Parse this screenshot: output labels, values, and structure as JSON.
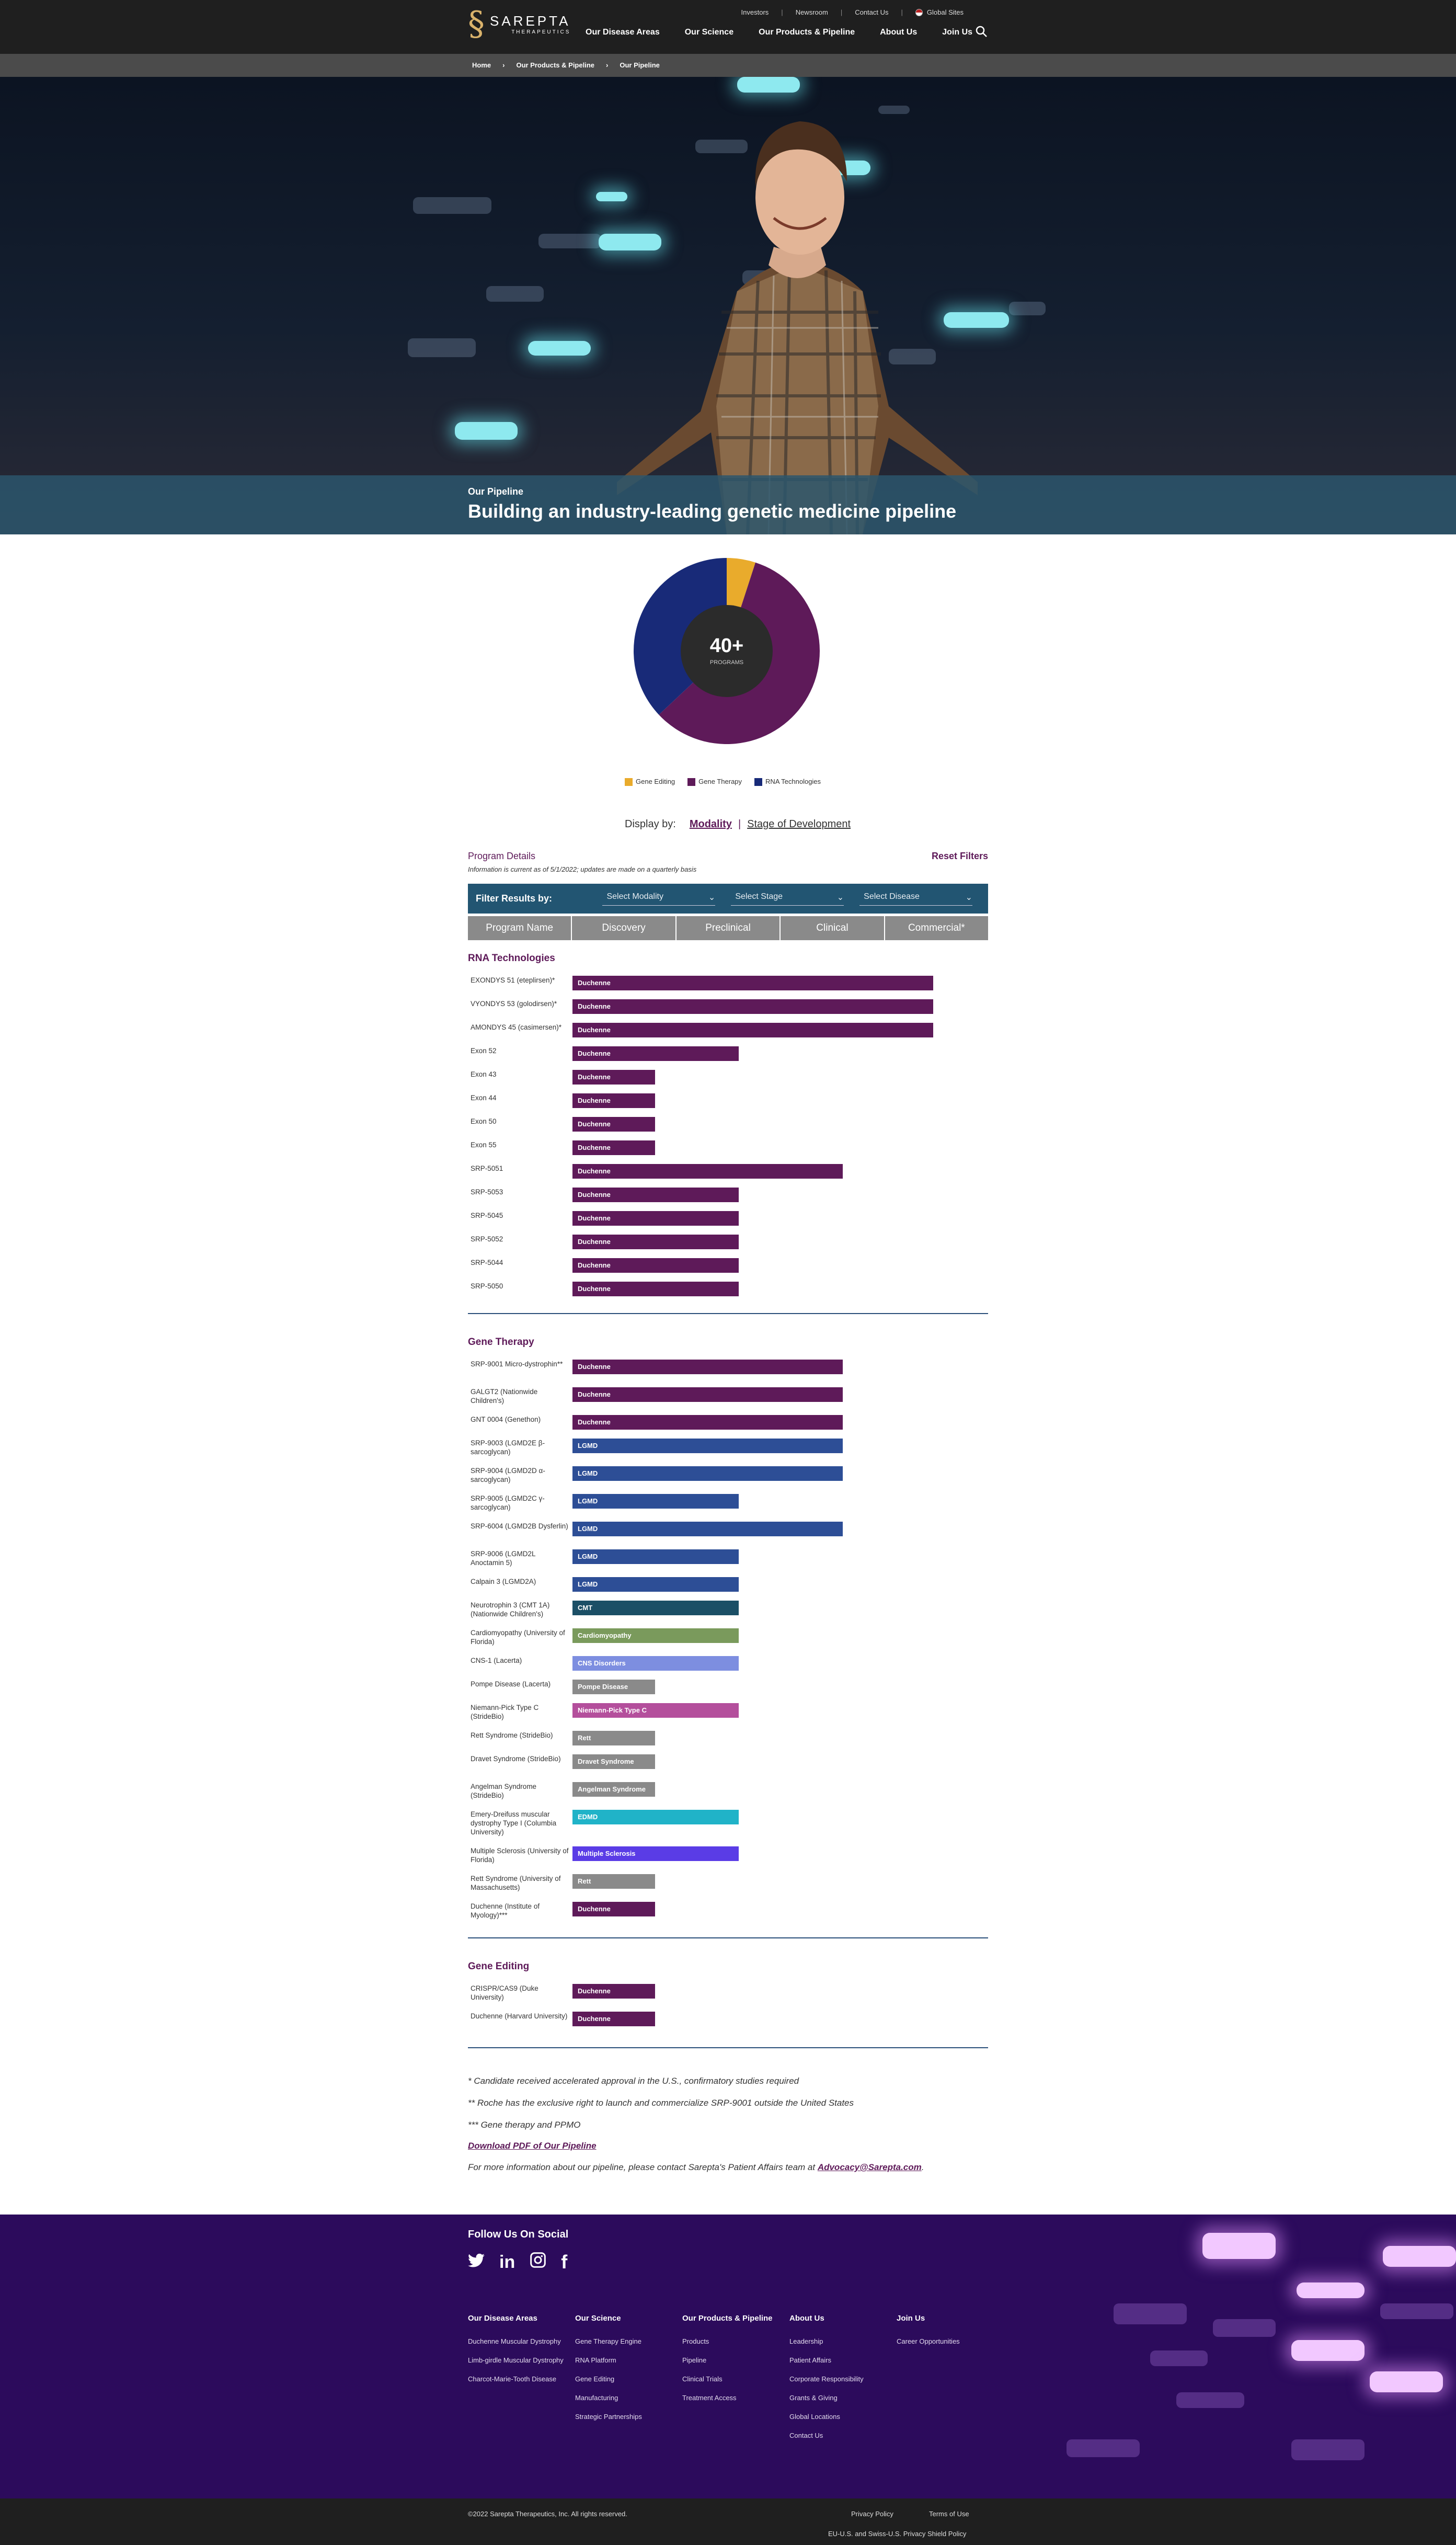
{
  "header": {
    "logo_name": "SAREPTA",
    "logo_sub": "THERAPEUTICS",
    "utility": [
      "Investors",
      "Newsroom",
      "Contact Us",
      "Global Sites"
    ],
    "nav": [
      "Our Disease Areas",
      "Our Science",
      "Our Products & Pipeline",
      "About Us",
      "Join Us"
    ]
  },
  "breadcrumb": [
    "Home",
    "Our Products & Pipeline",
    "Our Pipeline"
  ],
  "hero": {
    "subtitle": "Our Pipeline",
    "title": "Building an industry-leading genetic medicine pipeline"
  },
  "pie": {
    "center_value": "40+",
    "center_label": "PROGRAMS",
    "slices": [
      {
        "name": "Gene Editing",
        "fraction": 0.05,
        "color": "#e9ab2c"
      },
      {
        "name": "Gene Therapy",
        "fraction": 0.58,
        "color": "#5e1a59"
      },
      {
        "name": "RNA Technologies",
        "fraction": 0.37,
        "color": "#182a78"
      }
    ]
  },
  "display_by": {
    "label": "Display by:",
    "option1": "Modality",
    "option2": "Stage of Development"
  },
  "program_details": {
    "title": "Program Details",
    "reset": "Reset Filters",
    "note": "Information is current as of 5/1/2022; updates are made on a quarterly basis"
  },
  "filters": {
    "label": "Filter Results by:",
    "modality": "Select Modality",
    "stage": "Select Stage",
    "disease": "Select Disease"
  },
  "columns": [
    "Program Name",
    "Discovery",
    "Preclinical",
    "Clinical",
    "Commercial*"
  ],
  "sections": [
    {
      "title": "RNA Technologies",
      "rows": [
        {
          "name": "EXONDYS 51 (eteplirsen)*",
          "label": "Duchenne",
          "stage": 4,
          "color": "#5e1a59"
        },
        {
          "name": "VYONDYS 53 (golodirsen)*",
          "label": "Duchenne",
          "stage": 4,
          "color": "#5e1a59"
        },
        {
          "name": "AMONDYS 45 (casimersen)*",
          "label": "Duchenne",
          "stage": 4,
          "color": "#5e1a59"
        },
        {
          "name": "Exon 52",
          "label": "Duchenne",
          "stage": 2,
          "color": "#5e1a59"
        },
        {
          "name": "Exon 43",
          "label": "Duchenne",
          "stage": 1,
          "color": "#5e1a59"
        },
        {
          "name": "Exon 44",
          "label": "Duchenne",
          "stage": 1,
          "color": "#5e1a59"
        },
        {
          "name": "Exon 50",
          "label": "Duchenne",
          "stage": 1,
          "color": "#5e1a59"
        },
        {
          "name": "Exon 55",
          "label": "Duchenne",
          "stage": 1,
          "color": "#5e1a59"
        },
        {
          "name": "SRP-5051",
          "label": "Duchenne",
          "stage": 3,
          "color": "#5e1a59"
        },
        {
          "name": "SRP-5053",
          "label": "Duchenne",
          "stage": 2,
          "color": "#5e1a59"
        },
        {
          "name": "SRP-5045",
          "label": "Duchenne",
          "stage": 2,
          "color": "#5e1a59"
        },
        {
          "name": "SRP-5052",
          "label": "Duchenne",
          "stage": 2,
          "color": "#5e1a59"
        },
        {
          "name": "SRP-5044",
          "label": "Duchenne",
          "stage": 2,
          "color": "#5e1a59"
        },
        {
          "name": "SRP-5050",
          "label": "Duchenne",
          "stage": 2,
          "color": "#5e1a59"
        }
      ]
    },
    {
      "title": "Gene Therapy",
      "rows": [
        {
          "name": "SRP-9001 Micro-dystrophin**",
          "label": "Duchenne",
          "stage": 3,
          "color": "#5e1a59"
        },
        {
          "name": "GALGT2 (Nationwide Children's)",
          "label": "Duchenne",
          "stage": 3,
          "color": "#5e1a59"
        },
        {
          "name": "GNT 0004 (Genethon)",
          "label": "Duchenne",
          "stage": 3,
          "color": "#5e1a59"
        },
        {
          "name": "SRP-9003 (LGMD2E β-sarcoglycan)",
          "label": "LGMD",
          "stage": 3,
          "color": "#2d4e96"
        },
        {
          "name": "SRP-9004 (LGMD2D α-sarcoglycan)",
          "label": "LGMD",
          "stage": 3,
          "color": "#2d4e96"
        },
        {
          "name": "SRP-9005 (LGMD2C γ-sarcoglycan)",
          "label": "LGMD",
          "stage": 2,
          "color": "#2d4e96"
        },
        {
          "name": "SRP-6004 (LGMD2B Dysferlin)",
          "label": "LGMD",
          "stage": 3,
          "color": "#2d4e96"
        },
        {
          "name": "SRP-9006 (LGMD2L Anoctamin 5)",
          "label": "LGMD",
          "stage": 2,
          "color": "#2d4e96"
        },
        {
          "name": "Calpain 3 (LGMD2A)",
          "label": "LGMD",
          "stage": 2,
          "color": "#2d4e96"
        },
        {
          "name": "Neurotrophin 3 (CMT 1A) (Nationwide Children's)",
          "label": "CMT",
          "stage": 2,
          "color": "#1b4f66"
        },
        {
          "name": "Cardiomyopathy (University of Florida)",
          "label": "Cardiomyopathy",
          "stage": 2,
          "color": "#7a9a5c"
        },
        {
          "name": "CNS-1 (Lacerta)",
          "label": "CNS Disorders",
          "stage": 2,
          "color": "#7d8ee0"
        },
        {
          "name": "Pompe Disease (Lacerta)",
          "label": "Pompe Disease",
          "stage": 1,
          "color": "#8a8a8a"
        },
        {
          "name": "Niemann-Pick Type C (StrideBio)",
          "label": "Niemann-Pick Type C",
          "stage": 2,
          "color": "#b44f9c"
        },
        {
          "name": "Rett Syndrome (StrideBio)",
          "label": "Rett",
          "stage": 1,
          "color": "#8a8a8a"
        },
        {
          "name": "Dravet Syndrome (StrideBio)",
          "label": "Dravet Syndrome",
          "stage": 1,
          "color": "#8a8a8a"
        },
        {
          "name": "Angelman Syndrome (StrideBio)",
          "label": "Angelman Syndrome",
          "stage": 1,
          "color": "#8a8a8a"
        },
        {
          "name": "Emery-Dreifuss muscular dystrophy Type I (Columbia University)",
          "label": "EDMD",
          "stage": 2,
          "color": "#20b3c8"
        },
        {
          "name": "Multiple Sclerosis (University of Florida)",
          "label": "Multiple Sclerosis",
          "stage": 2,
          "color": "#5a3ce6"
        },
        {
          "name": "Rett Syndrome (University of Massachusetts)",
          "label": "Rett",
          "stage": 1,
          "color": "#8a8a8a"
        },
        {
          "name": "Duchenne (Institute of Myology)***",
          "label": "Duchenne",
          "stage": 1,
          "color": "#5e1a59"
        }
      ]
    },
    {
      "title": "Gene Editing",
      "rows": [
        {
          "name": "CRISPR/CAS9 (Duke University)",
          "label": "Duchenne",
          "stage": 1,
          "color": "#5e1a59"
        },
        {
          "name": "Duchenne (Harvard University)",
          "label": "Duchenne",
          "stage": 1,
          "color": "#5e1a59"
        }
      ]
    }
  ],
  "footnotes": {
    "n1": "* Candidate received accelerated approval in the U.S., confirmatory studies required",
    "n2": "** Roche has the exclusive right to launch and commercialize SRP-9001 outside the United States",
    "n3": "*** Gene therapy and PPMO",
    "pdf": "Download PDF of Our Pipeline",
    "contact": "For more information about our pipeline, please contact Sarepta's Patient Affairs team at ",
    "email": "Advocacy@Sarepta.com"
  },
  "footer": {
    "follow": "Follow Us On Social",
    "social": [
      "twitter-icon",
      "linkedin-icon",
      "instagram-icon",
      "facebook-icon"
    ],
    "columns": [
      {
        "title": "Our Disease Areas",
        "links": [
          "Duchenne Muscular Dystrophy",
          "Limb-girdle Muscular Dystrophy",
          "Charcot-Marie-Tooth Disease"
        ]
      },
      {
        "title": "Our Science",
        "links": [
          "Gene Therapy Engine",
          "RNA Platform",
          "Gene Editing",
          "Manufacturing",
          "Strategic Partnerships"
        ]
      },
      {
        "title": "Our Products & Pipeline",
        "links": [
          "Products",
          "Pipeline",
          "Clinical Trials",
          "Treatment Access"
        ]
      },
      {
        "title": "About Us",
        "links": [
          "Leadership",
          "Patient Affairs",
          "Corporate Responsibility",
          "Grants & Giving",
          "Global Locations",
          "Contact Us"
        ]
      },
      {
        "title": "Join Us",
        "links": [
          "Career Opportunities"
        ]
      }
    ],
    "copyright": "©2022 Sarepta Therapeutics, Inc. All rights reserved.",
    "privacy": "Privacy Policy",
    "terms": "Terms of Use",
    "shield": "EU-U.S. and Swiss-U.S. Privacy Shield Policy"
  }
}
